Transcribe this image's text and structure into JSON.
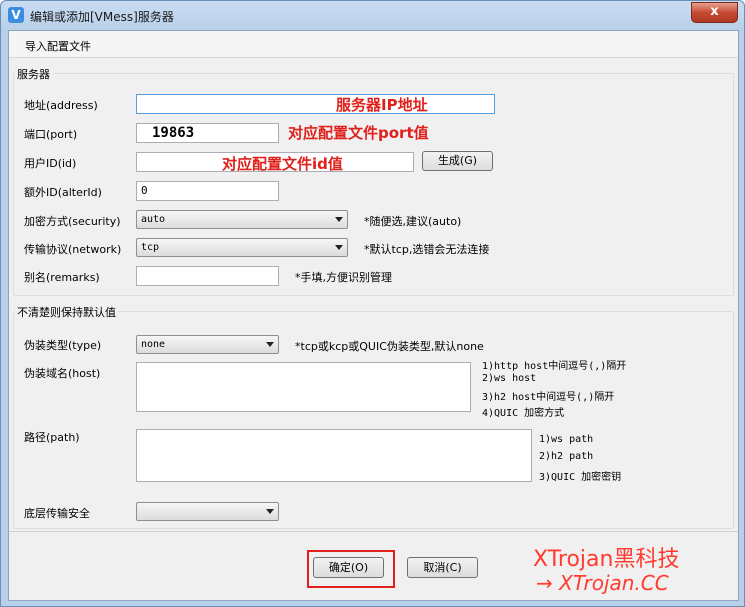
{
  "window": {
    "title": "编辑或添加[VMess]服务器",
    "close_symbol": "x",
    "app_icon": "V"
  },
  "menu": {
    "import_label": "导入配置文件"
  },
  "server_group": {
    "legend": "服务器",
    "address_label": "地址(address)",
    "address_value": "",
    "address_annotation": "服务器IP地址",
    "port_label": "端口(port)",
    "port_value": "19863",
    "port_annotation": "对应配置文件port值",
    "id_label": "用户ID(id)",
    "id_value": "",
    "id_annotation": "对应配置文件id值",
    "generate_button": "生成(G)",
    "alterid_label": "额外ID(alterId)",
    "alterid_value": "0",
    "security_label": "加密方式(security)",
    "security_value": "auto",
    "security_hint": "*随便选,建议(auto)",
    "network_label": "传输协议(network)",
    "network_value": "tcp",
    "network_hint": "*默认tcp,选错会无法连接",
    "remarks_label": "别名(remarks)",
    "remarks_value": "",
    "remarks_hint": "*手填,方便识别管理"
  },
  "default_group": {
    "legend": "不清楚则保持默认值",
    "type_label": "伪装类型(type)",
    "type_value": "none",
    "type_hint": "*tcp或kcp或QUIC伪装类型,默认none",
    "host_label": "伪装域名(host)",
    "host_hints": [
      "1)http host中间逗号(,)隔开",
      "2)ws host",
      "3)h2 host中间逗号(,)隔开",
      "4)QUIC 加密方式"
    ],
    "path_label": "路径(path)",
    "path_hints": [
      "1)ws path",
      "2)h2 path",
      "3)QUIC 加密密钥"
    ],
    "tls_label": "底层传输安全",
    "tls_value": ""
  },
  "footer": {
    "ok_button": "确定(O)",
    "cancel_button": "取消(C)"
  },
  "watermark": {
    "line1": "XTrojan黑科技",
    "line2": "→ XTrojan.CC"
  },
  "colors": {
    "annotation": "#e0201a",
    "watermark": "#ff3b2f",
    "titlebar": "#c9dcf2"
  }
}
